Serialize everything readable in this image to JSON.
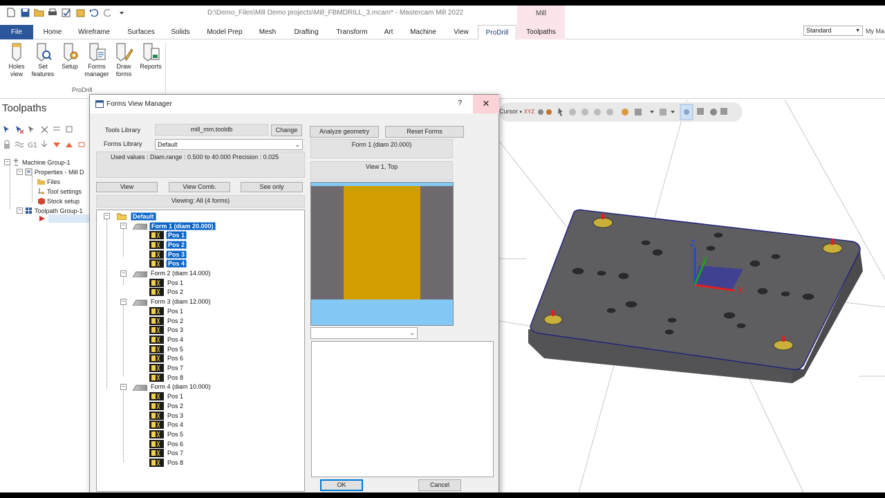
{
  "window": {
    "title": "D:\\Demo_Files\\Mill Demo projects\\Mill_FBMDRILL_3.mcam* - Mastercam Mill 2022",
    "context_tab_group": "Mill"
  },
  "ribbon": {
    "tabs": [
      "File",
      "Home",
      "Wireframe",
      "Surfaces",
      "Solids",
      "Model Prep",
      "Mesh",
      "Drafting",
      "Transform",
      "Art",
      "Machine",
      "View",
      "ProDrill",
      "Toolpaths"
    ],
    "active_tab": "ProDrill",
    "buttons": [
      {
        "line1": "Holes",
        "line2": "view",
        "icon": "holes-view-icon"
      },
      {
        "line1": "Set",
        "line2": "features",
        "icon": "set-features-icon"
      },
      {
        "line1": "Setup",
        "line2": "",
        "icon": "setup-icon"
      },
      {
        "line1": "Forms",
        "line2": "manager",
        "icon": "forms-manager-icon"
      },
      {
        "line1": "Draw",
        "line2": "forms",
        "icon": "draw-forms-icon"
      },
      {
        "line1": "Reports",
        "line2": "",
        "icon": "reports-icon"
      }
    ],
    "group_label": "ProDrill",
    "style_select": "Standard",
    "right_text": "My Ma"
  },
  "toolpaths_panel": {
    "title": "Toolpaths",
    "tree": [
      {
        "label": "Machine Group-1",
        "icon": "machine-icon"
      },
      {
        "label": "Properties - Mill D",
        "icon": "properties-icon"
      },
      {
        "label": "Files",
        "icon": "folder-icon"
      },
      {
        "label": "Tool settings",
        "icon": "tool-settings-icon"
      },
      {
        "label": "Stock setup",
        "icon": "stock-icon"
      },
      {
        "label": "Toolpath Group-1",
        "icon": "toolpath-group-icon"
      }
    ]
  },
  "viewport": {
    "toolbar_label": "Cursor",
    "axis_labels": {
      "x": "X",
      "y": "Y",
      "z": "Z"
    },
    "colors": {
      "part": "#5b5b5e",
      "part_edge": "#1a1a7a",
      "hole_marker": "#c9b03a",
      "arrow": "#e02020"
    }
  },
  "dialog": {
    "title": "Forms View Manager",
    "help_label": "?",
    "close_label": "✕",
    "tools_library_label": "Tools Library",
    "tools_library_value": "mill_mm.tooldb",
    "change_button": "Change",
    "forms_library_label": "Forms Library",
    "forms_library_value": "Default",
    "used_values": "Used values : Diam.range : 0.500 to 40.000  Precision : 0.025",
    "view_button": "View",
    "view_comb_button": "View Comb.",
    "see_only_button": "See only",
    "viewing_text": "Viewing: All (4 forms)",
    "analyze_button": "Analyze geometry",
    "reset_button": "Reset Forms",
    "form_info": "Form  1 (diam 20.000)",
    "view_info": "View 1,  Top",
    "ok_button": "OK",
    "cancel_button": "Cancel",
    "preview_colors": {
      "background": "#6f6a6f",
      "hole": "#d09e00",
      "top_band": "#84c9f5",
      "bottom_band": "#84c9f5"
    },
    "tree": {
      "root": "Default",
      "forms": [
        {
          "label": "Form  1 (diam 20.000)",
          "selected": true,
          "positions": [
            "Pos 1",
            "Pos 2",
            "Pos 3",
            "Pos 4"
          ]
        },
        {
          "label": "Form  2 (diam 14.000)",
          "selected": false,
          "positions": [
            "Pos 1",
            "Pos 2"
          ]
        },
        {
          "label": "Form  3 (diam 12.000)",
          "selected": false,
          "positions": [
            "Pos 1",
            "Pos 2",
            "Pos 3",
            "Pos 4",
            "Pos 5",
            "Pos 6",
            "Pos 7",
            "Pos 8"
          ]
        },
        {
          "label": "Form  4 (diam 10.000)",
          "selected": false,
          "positions": [
            "Pos 1",
            "Pos 2",
            "Pos 3",
            "Pos 4",
            "Pos 5",
            "Pos 6",
            "Pos 7",
            "Pos 8"
          ]
        }
      ]
    }
  }
}
